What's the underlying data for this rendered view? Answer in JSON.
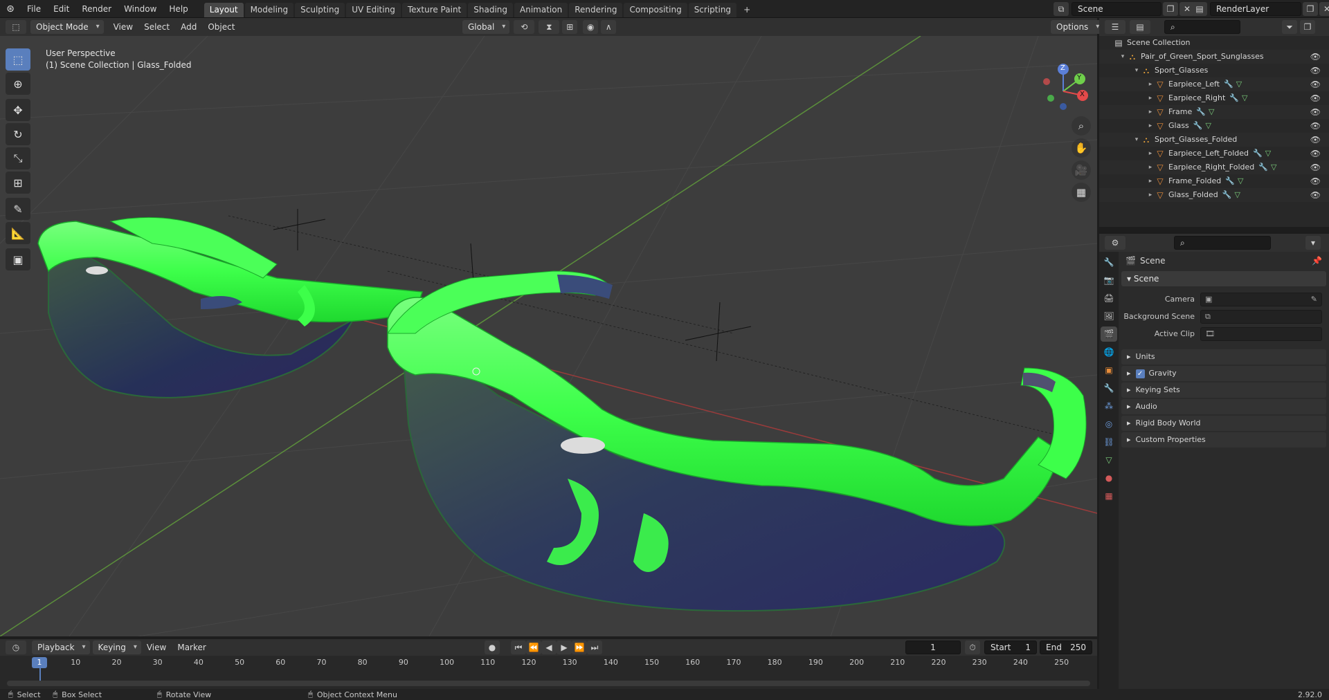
{
  "menu": [
    "File",
    "Edit",
    "Render",
    "Window",
    "Help"
  ],
  "workspaces": [
    "Layout",
    "Modeling",
    "Sculpting",
    "UV Editing",
    "Texture Paint",
    "Shading",
    "Animation",
    "Rendering",
    "Compositing",
    "Scripting"
  ],
  "add_tab": "+",
  "scene_name": "Scene",
  "render_layer": "RenderLayer",
  "viewport_header": {
    "mode": "Object Mode",
    "menus": [
      "View",
      "Select",
      "Add",
      "Object"
    ],
    "transform_orientation": "Global",
    "options": "Options"
  },
  "viewport": {
    "perspective": "User Perspective",
    "collection_info": "(1) Scene Collection | Glass_Folded",
    "gizmo": {
      "x": "X",
      "y": "Y",
      "z": "Z"
    }
  },
  "outliner": {
    "rows": [
      {
        "label": "Scene Collection",
        "indent": 0,
        "type": "scene"
      },
      {
        "label": "Pair_of_Green_Sport_Sunglasses",
        "indent": 1,
        "type": "collection"
      },
      {
        "label": "Sport_Glasses",
        "indent": 2,
        "type": "collection"
      },
      {
        "label": "Earpiece_Left",
        "indent": 3,
        "type": "object"
      },
      {
        "label": "Earpiece_Right",
        "indent": 3,
        "type": "object"
      },
      {
        "label": "Frame",
        "indent": 3,
        "type": "object"
      },
      {
        "label": "Glass",
        "indent": 3,
        "type": "object"
      },
      {
        "label": "Sport_Glasses_Folded",
        "indent": 2,
        "type": "collection"
      },
      {
        "label": "Earpiece_Left_Folded",
        "indent": 3,
        "type": "object"
      },
      {
        "label": "Earpiece_Right_Folded",
        "indent": 3,
        "type": "object"
      },
      {
        "label": "Frame_Folded",
        "indent": 3,
        "type": "object"
      },
      {
        "label": "Glass_Folded",
        "indent": 3,
        "type": "object"
      }
    ]
  },
  "properties": {
    "context": "Scene",
    "panel_title": "Scene",
    "fields": [
      {
        "label": "Camera"
      },
      {
        "label": "Background Scene"
      },
      {
        "label": "Active Clip"
      }
    ],
    "subpanels": [
      "Units",
      "Gravity",
      "Keying Sets",
      "Audio",
      "Rigid Body World",
      "Custom Properties"
    ]
  },
  "timeline": {
    "menus": [
      "Playback",
      "Keying",
      "View",
      "Marker"
    ],
    "current_frame": "1",
    "start_label": "Start",
    "start": "1",
    "end_label": "End",
    "end": "250",
    "ticks": [
      "10",
      "20",
      "30",
      "40",
      "50",
      "60",
      "70",
      "80",
      "90",
      "100",
      "110",
      "120",
      "130",
      "140",
      "150",
      "160",
      "170",
      "180",
      "190",
      "200",
      "210",
      "220",
      "230",
      "240",
      "250"
    ],
    "playhead": "1"
  },
  "status": {
    "select": "Select",
    "box_select": "Box Select",
    "rotate": "Rotate View",
    "context_menu": "Object Context Menu",
    "version": "2.92.0"
  },
  "colors": {
    "frame_green": "#3dff4a",
    "accent": "#5a7fbd",
    "viewport_bg": "#3d3d3d"
  }
}
